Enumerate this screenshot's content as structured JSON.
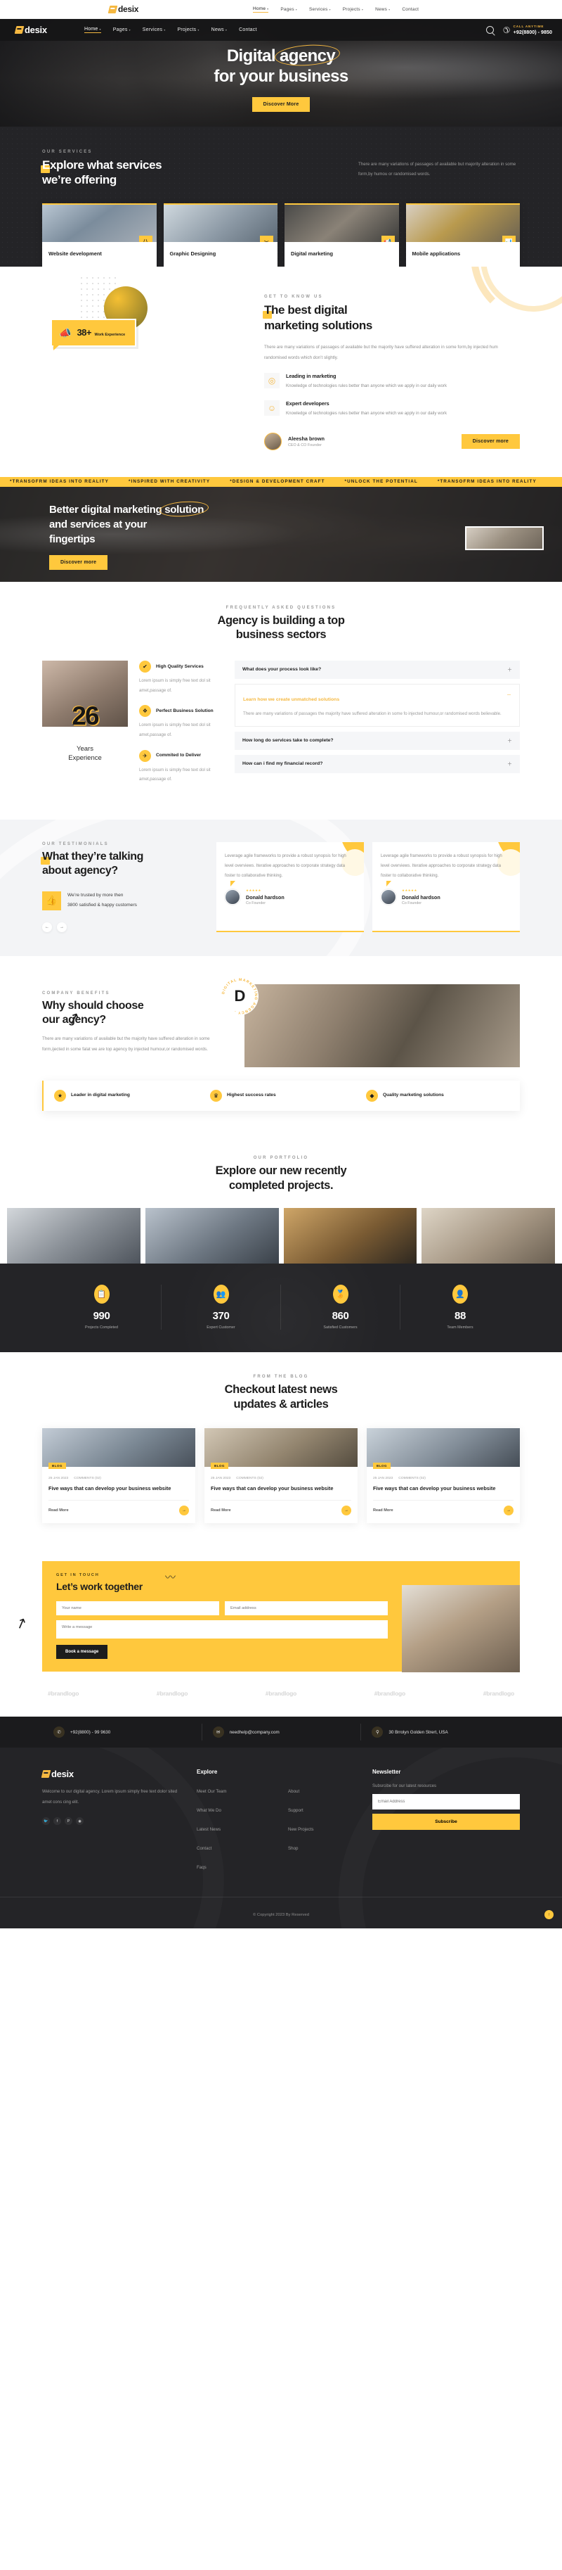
{
  "brand": {
    "name": "desix"
  },
  "topbar": {
    "nav": [
      {
        "label": "Home",
        "caret": true,
        "active": true
      },
      {
        "label": "Pages",
        "caret": true,
        "active": false
      },
      {
        "label": "Services",
        "caret": true,
        "active": false
      },
      {
        "label": "Projects",
        "caret": true,
        "active": false
      },
      {
        "label": "News",
        "caret": true,
        "active": false
      },
      {
        "label": "Contact",
        "caret": false,
        "active": false
      }
    ]
  },
  "header": {
    "nav": [
      {
        "label": "Home",
        "active": true
      },
      {
        "label": "Pages",
        "active": false
      },
      {
        "label": "Services",
        "active": false
      },
      {
        "label": "Projects",
        "active": false
      },
      {
        "label": "News",
        "active": false
      },
      {
        "label": "Contact",
        "active": false
      }
    ],
    "call_label": "CALL ANYTIME",
    "call_number": "+92(8800) - 9850"
  },
  "hero": {
    "title_1": "Digital",
    "title_highlight": "agency",
    "title_2": "for your business",
    "cta": "Discover More"
  },
  "services": {
    "eyebrow": "OUR SERVICES",
    "title_mark": "E",
    "title_rest": "xplore what services",
    "title_line2": "we’re offering",
    "description": "There are many variations of passages of available but majority alteration in some form,by humou or randomised words.",
    "cards": [
      {
        "title": "Website development",
        "icon": "code-icon",
        "glyph": "⟨⟩"
      },
      {
        "title": "Graphic Designing",
        "icon": "tools-icon",
        "glyph": "✂"
      },
      {
        "title": "Digital marketing",
        "icon": "megaphone-icon",
        "glyph": "📢"
      },
      {
        "title": "Mobile applications",
        "icon": "chart-icon",
        "glyph": "📊"
      }
    ]
  },
  "about": {
    "experience_number": "38+",
    "experience_label": "Work Experience",
    "eyebrow": "GET TO KNOW US",
    "title_mark": "T",
    "title_rest": "he best digital",
    "title_line2": "marketing solutions",
    "description": "There are many variations of passages of available but the majority have suffered alteration in some form,by injected hum randomised words which don’t slightly.",
    "features": [
      {
        "title": "Leading in marketing",
        "text": "Knowledge of technologies rules better than anyone which we apply in our daily work",
        "icon": "target-icon",
        "glyph": "◎"
      },
      {
        "title": "Expert developers",
        "text": "Knowledge of technologies rules better than anyone which we apply in our daily work",
        "icon": "developer-icon",
        "glyph": "☺"
      }
    ],
    "author_name": "Aleesha brown",
    "author_role": "CEO & CO Founder",
    "cta": "Discover more"
  },
  "marquee": {
    "items": [
      "*TRANSOFRM IDEAS INTO REALITY",
      "*INSPIRED WITH CREATIVITY",
      "*DESIGN & DEVELOPMENT CRAFT",
      "*UNLOCK THE POTENTIAL",
      "*TRANSOFRM IDEAS INTO REALITY"
    ]
  },
  "cta_banner": {
    "line1": "Better digital marketing",
    "highlight": "solution",
    "line2": "and services at your",
    "line3": "fingertips",
    "button": "Discover more"
  },
  "faq": {
    "eyebrow": "FREQUENTLY ASKED QUESTIONS",
    "title_mark": "b",
    "title_pre": "Agency is ",
    "title_post": "uilding a top",
    "title_line2": "business sectors",
    "years_number": "26",
    "years_label_1": "Years",
    "years_label_2": "Experience",
    "points": [
      {
        "title": "High Quality Services",
        "text": "Lorem ipsum is simply free text dol sit amet,passage of.",
        "icon": "check-icon",
        "glyph": "✔"
      },
      {
        "title": "Perfect Business Solution",
        "text": "Lorem ipsum is simply free text dol sit amet,passage of.",
        "icon": "briefcase-icon",
        "glyph": "❖"
      },
      {
        "title": "Commited to Deliver",
        "text": "Lorem ipsum is simply free text dol sit amet,passage of.",
        "icon": "delivery-icon",
        "glyph": "✈"
      }
    ],
    "items": [
      {
        "q": "What does your process look like?",
        "open": false,
        "a": ""
      },
      {
        "q": "Learn how we create unmatched solutions",
        "open": true,
        "a": "There are many variations of passages the majority have suffered alteration in some fo injected humour,or randomised words believable."
      },
      {
        "q": "How long do services take to complete?",
        "open": false,
        "a": ""
      },
      {
        "q": "How can i find my financial record?",
        "open": false,
        "a": ""
      }
    ]
  },
  "testimonials": {
    "eyebrow": "OUR TESTIMONIALS",
    "title_mark": "W",
    "title_rest": "hat they’re talking",
    "title_line2": "about agency?",
    "trust_line1": "We’re trusted by more then",
    "trust_line2": "3800 satisfied & happy customers",
    "cards": [
      {
        "text": "Leverage agile frameworks to provide a robust synopsis for high level overviews. Iterative approaches to corporate strategy data foster to collaborative thinking.",
        "name": "Donald hardson",
        "role": "Co Founder",
        "stars": "★★★★★"
      },
      {
        "text": "Leverage agile frameworks to provide a robust synopsis for high level overviews. Iterative approaches to corporate strategy data foster to collaborative thinking.",
        "name": "Donald hardson",
        "role": "Co Founder",
        "stars": "★★★★★"
      }
    ]
  },
  "benefits": {
    "eyebrow": "COMPANY BENEFITS",
    "title_mark": "W",
    "title_rest": "hy should choose",
    "title_line2": "our agency?",
    "description": "There are many variations of available but the majority have suffered alteration in some form,ijected in  some falat we are top agency by injected humour,or randomised words.",
    "badge_letter": "D",
    "badge_text": "DIGITAL MARKETING AGENCY .",
    "cards": [
      {
        "title": "Leader in digital marketing",
        "icon": "star-icon",
        "glyph": "★"
      },
      {
        "title": "Highest success rates",
        "icon": "trophy-icon",
        "glyph": "♛"
      },
      {
        "title": "Quality marketing solutions",
        "icon": "gem-icon",
        "glyph": "◆"
      }
    ]
  },
  "portfolio": {
    "eyebrow": "OUR PORTFOLIO",
    "title_pre": "Explore our ",
    "title_mark": "n",
    "title_post": "ew recently",
    "title_line2": "completed projects."
  },
  "stats": {
    "items": [
      {
        "number": "990",
        "label": "Projects Completed",
        "icon": "clipboard-icon",
        "glyph": "📋"
      },
      {
        "number": "370",
        "label": "Expert Customer",
        "icon": "team-icon",
        "glyph": "👥"
      },
      {
        "number": "860",
        "label": "Satisfied Customers",
        "icon": "rating-icon",
        "glyph": "🏅"
      },
      {
        "number": "88",
        "label": "Team Members",
        "icon": "members-icon",
        "glyph": "👤"
      }
    ]
  },
  "blog": {
    "eyebrow": "FROM THE BLOG",
    "title_pre": "Checkout ",
    "title_mark": "l",
    "title_post": "atest news",
    "title_line2": "updates & articles",
    "posts": [
      {
        "tag": "BLOG",
        "date": "25 JAN 2023",
        "comments": "COMMENTS (02)",
        "title": "Five ways that can develop your business website",
        "link": "Read More"
      },
      {
        "tag": "BLOG",
        "date": "25 JAN 2023",
        "comments": "COMMENTS (02)",
        "title": "Five ways that can develop your business website",
        "link": "Read More"
      },
      {
        "tag": "BLOG",
        "date": "25 JAN 2023",
        "comments": "COMMENTS (02)",
        "title": "Five ways that can develop your business website",
        "link": "Read More"
      }
    ]
  },
  "contact": {
    "eyebrow": "GET IN TOUCH",
    "title": "Let’s work together",
    "name_placeholder": "Your name",
    "email_placeholder": "Email address",
    "message_placeholder": "Write a message",
    "button": "Book a message",
    "brands": [
      "#brandlogo",
      "#brandlogo",
      "#brandlogo",
      "#brandlogo",
      "#brandlogo"
    ]
  },
  "infobar": {
    "items": [
      {
        "icon": "phone-icon",
        "glyph": "✆",
        "text": "+92(8800) - 99 9630"
      },
      {
        "icon": "mail-icon",
        "glyph": "✉",
        "text": "needhelp@company.com"
      },
      {
        "icon": "location-icon",
        "glyph": "⚲",
        "text": "30 Brrolyn Golden Strert, USA"
      }
    ]
  },
  "footer": {
    "about": "Welcome to our digital agency. Lorem ipsum simply free text dolor sited amet cons cing elit.",
    "socials": [
      {
        "name": "twitter-icon",
        "glyph": "🐦"
      },
      {
        "name": "facebook-icon",
        "glyph": "f"
      },
      {
        "name": "pinterest-icon",
        "glyph": "P"
      },
      {
        "name": "instagram-icon",
        "glyph": "◉"
      }
    ],
    "explore_heading": "Explore",
    "explore_col1": [
      "Meet Our Team",
      "What We Do",
      "Latest News",
      "Contact",
      "Faqs"
    ],
    "explore_col2": [
      "About",
      "Support",
      "New Projects",
      "Shop"
    ],
    "newsletter_heading": "Newsletter",
    "newsletter_text": "Subsrcibe for our latest resources",
    "email_placeholder": "Email Address",
    "subscribe": "Subscribe",
    "copyright": "© Copyright 2023 By Reserved"
  },
  "colors": {
    "accent": "#FFC83D",
    "dark": "#242427",
    "gold": "#F5B841"
  }
}
